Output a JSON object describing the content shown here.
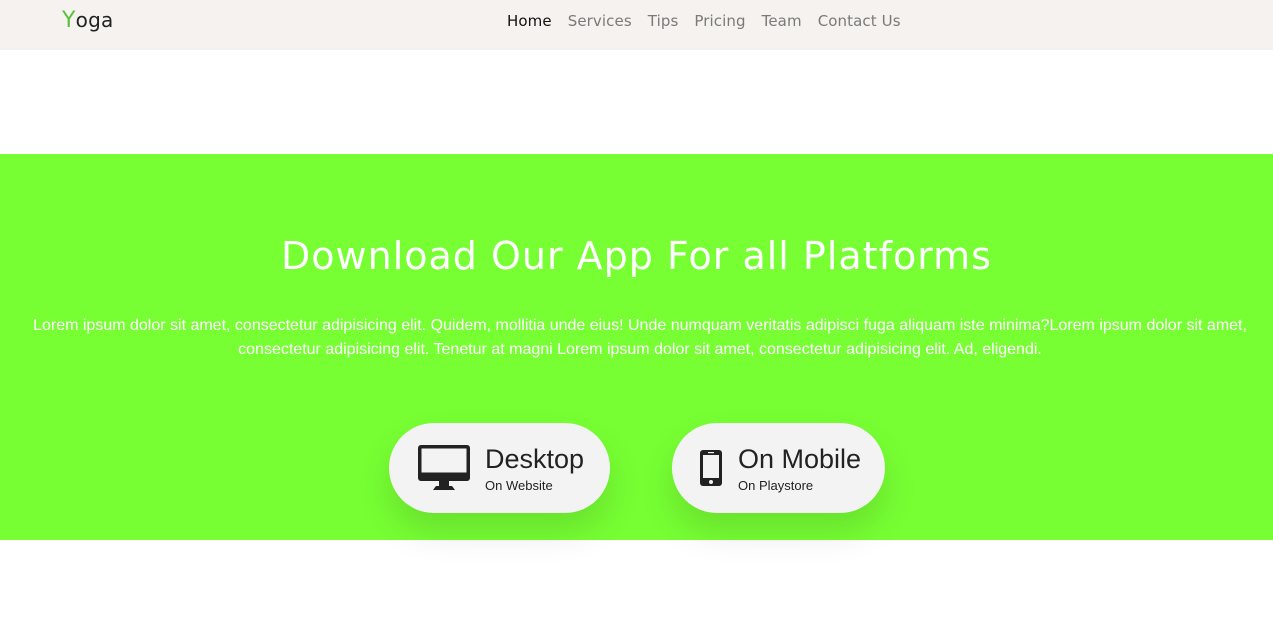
{
  "brand": {
    "first_letter": "Y",
    "rest": "oga"
  },
  "nav": {
    "items": [
      {
        "label": "Home"
      },
      {
        "label": "Services"
      },
      {
        "label": "Tips"
      },
      {
        "label": "Pricing"
      },
      {
        "label": "Team"
      },
      {
        "label": "Contact Us"
      }
    ]
  },
  "download": {
    "title": "Download Our App For all Platforms",
    "description": "Lorem ipsum dolor sit amet, consectetur adipisicing elit. Quidem, mollitia unde eius! Unde numquam veritatis adipisci fuga aliquam iste minima?Lorem ipsum dolor sit amet, consectetur adipisicing elit. Tenetur at magni Lorem ipsum dolor sit amet, consectetur adipisicing elit. Ad, eligendi.",
    "buttons": [
      {
        "icon": "desktop-icon",
        "title": "Desktop",
        "subtitle": "On Website"
      },
      {
        "icon": "mobile-phone-icon",
        "title": "On Mobile",
        "subtitle": "On Playstore"
      }
    ]
  },
  "colors": {
    "navbar_bg": "#f5f2f0",
    "brand_accent": "#59c03b",
    "section_bg": "#77ff33",
    "button_bg": "#f3f3f3",
    "icon_color": "#222222"
  }
}
